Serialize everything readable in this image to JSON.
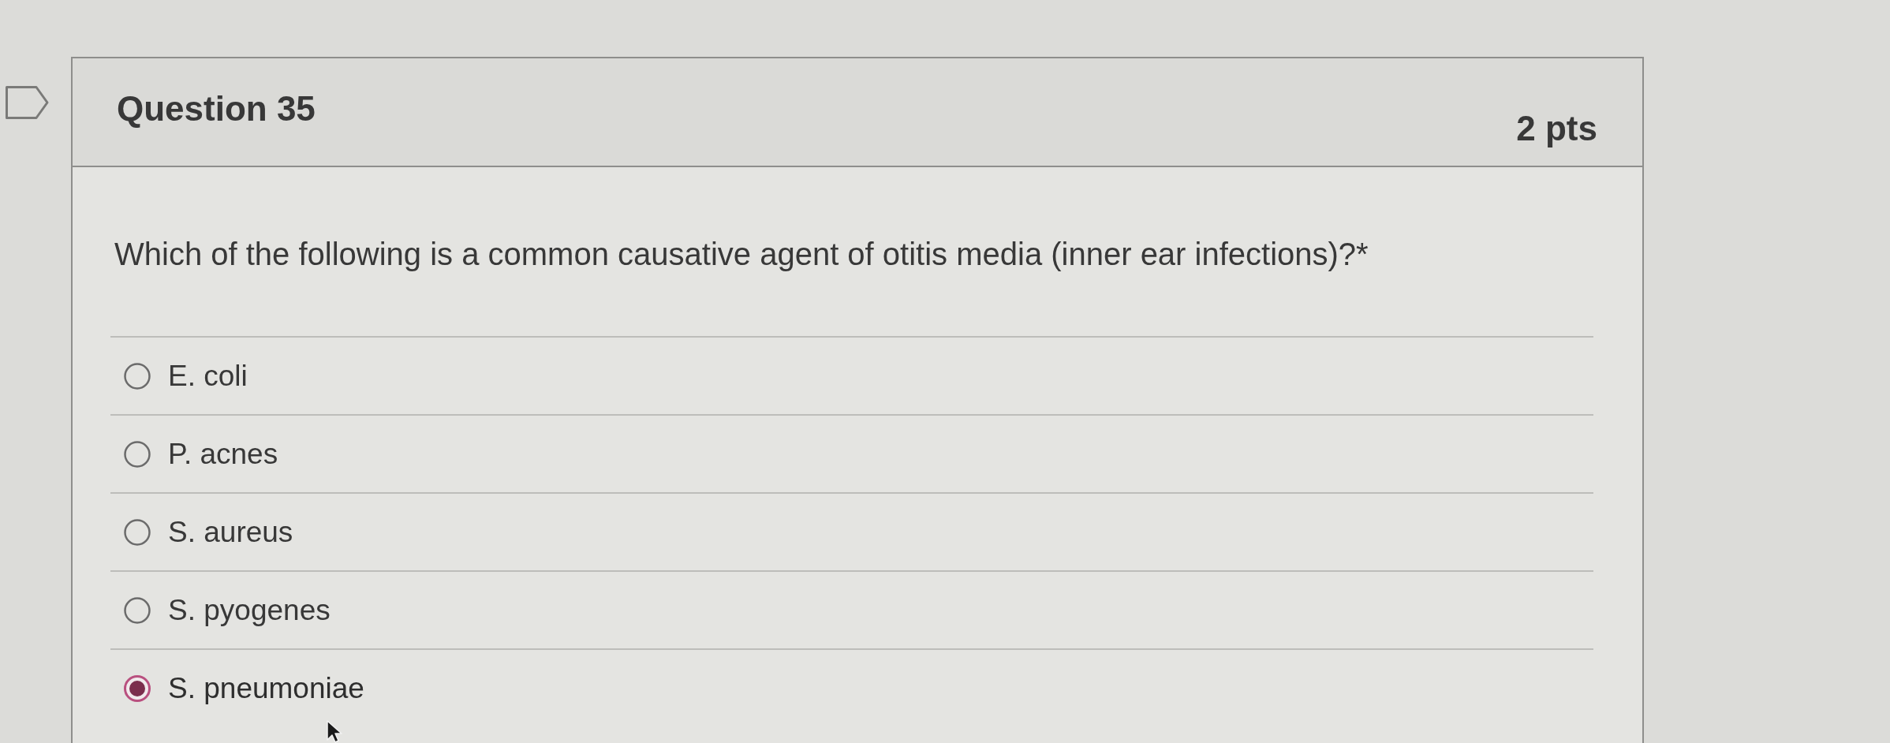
{
  "flag": {
    "flagged": false
  },
  "question": {
    "title": "Question 35",
    "points": "2 pts",
    "prompt": "Which of the following is a common causative agent of otitis media (inner ear infections)?*",
    "answers": [
      {
        "label": "E. coli",
        "selected": false
      },
      {
        "label": "P. acnes",
        "selected": false
      },
      {
        "label": "S. aureus",
        "selected": false
      },
      {
        "label": "S. pyogenes",
        "selected": false
      },
      {
        "label": "S. pneumoniae",
        "selected": true
      }
    ]
  }
}
